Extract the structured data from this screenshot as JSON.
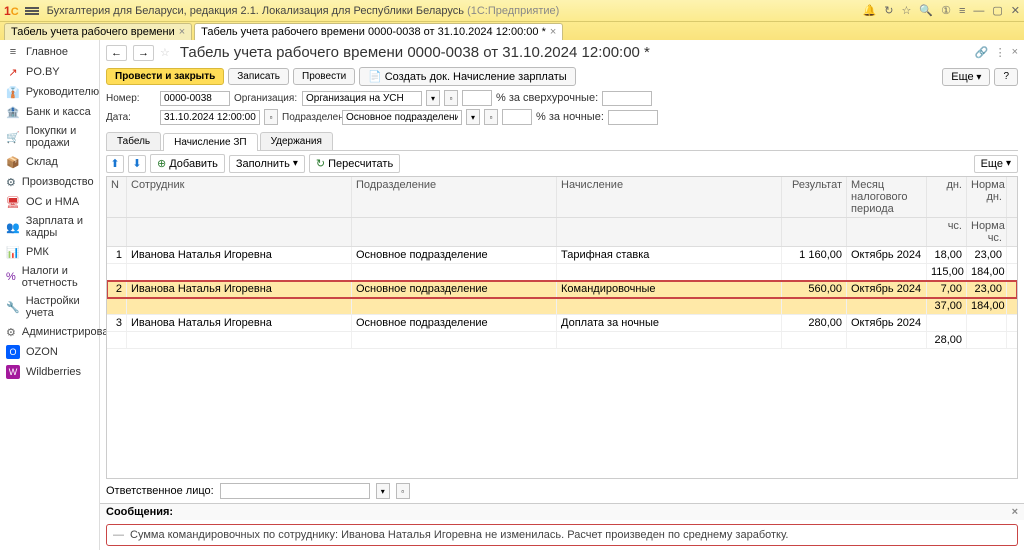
{
  "title": {
    "app": "Бухгалтерия для Беларуси, редакция 2.1. Локализация для Республики Беларусь",
    "mode": "(1С:Предприятие)"
  },
  "tabs": [
    {
      "label": "Табель учета рабочего времени"
    },
    {
      "label": "Табель учета рабочего времени 0000-0038 от 31.10.2024 12:00:00 *"
    }
  ],
  "sidebar": [
    {
      "icon": "≡",
      "label": "Главное",
      "color": "#4a4a4a"
    },
    {
      "icon": "↗",
      "label": "PO.BY",
      "color": "#d62c1a"
    },
    {
      "icon": "👔",
      "label": "Руководителю",
      "color": "#7cb342"
    },
    {
      "icon": "🏦",
      "label": "Банк и касса",
      "color": "#fb8c00"
    },
    {
      "icon": "🛒",
      "label": "Покупки и продажи",
      "color": "#1976d2"
    },
    {
      "icon": "📦",
      "label": "Склад",
      "color": "#8e6e63"
    },
    {
      "icon": "⚙",
      "label": "Производство",
      "color": "#455a64"
    },
    {
      "icon": "🖥",
      "label": "ОС и НМА",
      "color": "#d32f2f"
    },
    {
      "icon": "👥",
      "label": "Зарплата и кадры",
      "color": "#009688"
    },
    {
      "icon": "📊",
      "label": "РМК",
      "color": "#1976d2"
    },
    {
      "icon": "%",
      "label": "Налоги и отчетность",
      "color": "#7b1fa2"
    },
    {
      "icon": "🔧",
      "label": "Настройки учета",
      "color": "#689f38"
    },
    {
      "icon": "⚙",
      "label": "Администрирование",
      "color": "#616161"
    },
    {
      "icon": "O",
      "label": "OZON",
      "color": "#005bff"
    },
    {
      "icon": "W",
      "label": "Wildberries",
      "color": "#a3199c"
    }
  ],
  "doc": {
    "title": "Табель учета рабочего времени 0000-0038 от 31.10.2024 12:00:00 *",
    "buttons": {
      "post_close": "Провести и закрыть",
      "save": "Записать",
      "post": "Провести",
      "create_doc": "Создать док. Начисление зарплаты",
      "more": "Еще",
      "help": "?"
    },
    "fields": {
      "number_lbl": "Номер:",
      "number": "0000-0038",
      "date_lbl": "Дата:",
      "date": "31.10.2024 12:00:00",
      "org_lbl": "Организация:",
      "org": "Организация на УСН",
      "dep_lbl": "Подразделение:",
      "dep": "Основное подразделение",
      "overtime": "% за сверхурочные:",
      "night": "% за ночные:"
    },
    "subtabs": [
      "Табель",
      "Начисление ЗП",
      "Удержания"
    ],
    "tabletools": {
      "add": "Добавить",
      "fill": "Заполнить",
      "recalc": "Пересчитать",
      "more": "Еще"
    },
    "columns": {
      "n": "N",
      "emp": "Сотрудник",
      "dep": "Подразделение",
      "acc": "Начисление",
      "res": "Результат",
      "per": "Месяц налогового периода",
      "dn": "дн.",
      "norm": "Норма дн.",
      "hr": "чс.",
      "normh": "Норма чс."
    },
    "rows": [
      {
        "n": "1",
        "emp": "Иванова Наталья Игоревна",
        "dep": "Основное подразделение",
        "acc": "Тарифная ставка",
        "res": "1 160,00",
        "per": "Октябрь 2024",
        "dn": "18,00",
        "norm": "23,00",
        "hr": "115,00",
        "normh": "184,00"
      },
      {
        "n": "2",
        "emp": "Иванова Наталья Игоревна",
        "dep": "Основное подразделение",
        "acc": "Командировочные",
        "res": "560,00",
        "per": "Октябрь 2024",
        "dn": "7,00",
        "norm": "23,00",
        "hr": "37,00",
        "normh": "184,00"
      },
      {
        "n": "3",
        "emp": "Иванова Наталья Игоревна",
        "dep": "Основное подразделение",
        "acc": "Доплата за ночные",
        "res": "280,00",
        "per": "Октябрь 2024",
        "dn": "",
        "norm": "",
        "hr": "28,00",
        "normh": ""
      }
    ],
    "resp_lbl": "Ответственное лицо:",
    "msg_hdr": "Сообщения:",
    "msg": "Сумма командировочных по сотруднику: Иванова Наталья Игоревна не изменилась. Расчет произведен по среднему заработку."
  }
}
